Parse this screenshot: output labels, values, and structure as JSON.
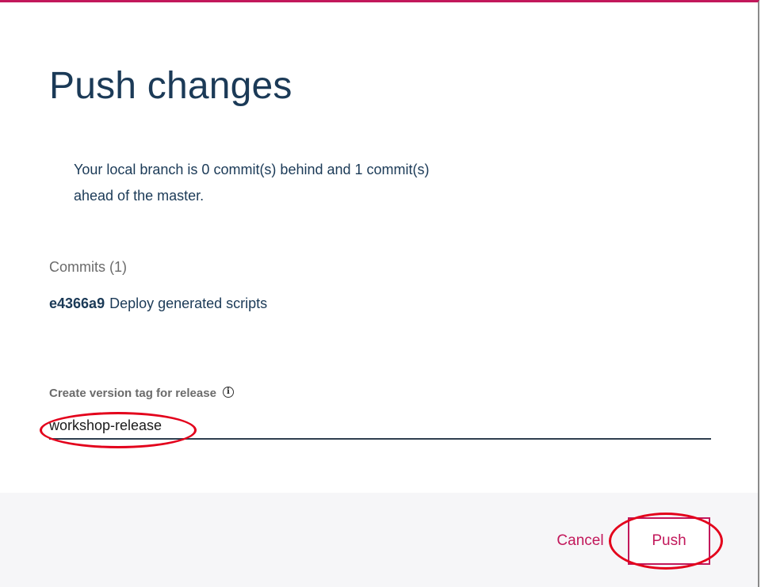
{
  "dialog": {
    "title": "Push changes",
    "status_line_1": "Your local branch is 0 commit(s) behind and 1 commit(s)",
    "status_line_2": "ahead of the master.",
    "commits_heading": "Commits (1)",
    "commits": [
      {
        "hash": "e4366a9",
        "message": "Deploy generated scripts"
      }
    ],
    "tag_label": "Create version tag for release",
    "tag_value": "workshop-release",
    "info_icon": "info-icon"
  },
  "footer": {
    "cancel_label": "Cancel",
    "push_label": "Push"
  },
  "colors": {
    "accent": "#c2185b",
    "title": "#1b3a57",
    "annotation": "#e3001b",
    "footer_bg": "#f6f6f8"
  }
}
